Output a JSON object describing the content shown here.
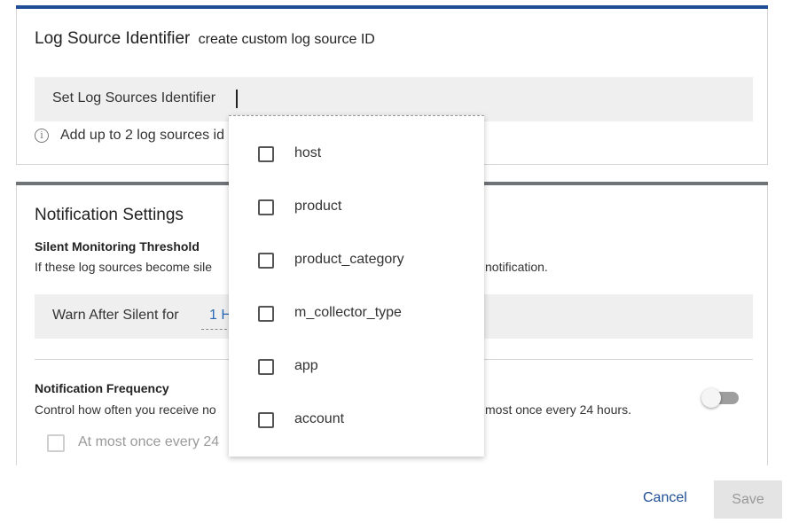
{
  "source_id": {
    "title": "Log Source Identifier",
    "subtitle": "create custom log source ID",
    "field_label": "Set Log Sources Identifier",
    "hint": "Add up to 2 log sources id"
  },
  "notification": {
    "title": "Notification Settings",
    "silent_title": "Silent Monitoring Threshold",
    "silent_desc_left": "If these log sources become sile",
    "silent_desc_right": "notification.",
    "warn_label": "Warn After Silent for",
    "warn_value": "1 H",
    "freq_title": "Notification Frequency",
    "freq_desc_left": "Control how often you receive no",
    "freq_desc_right": "most once every 24 hours.",
    "freq_option": "At most once every 24"
  },
  "dropdown": {
    "options": [
      "host",
      "product",
      "product_category",
      "m_collector_type",
      "app",
      "account"
    ]
  },
  "footer": {
    "cancel": "Cancel",
    "save": "Save"
  }
}
